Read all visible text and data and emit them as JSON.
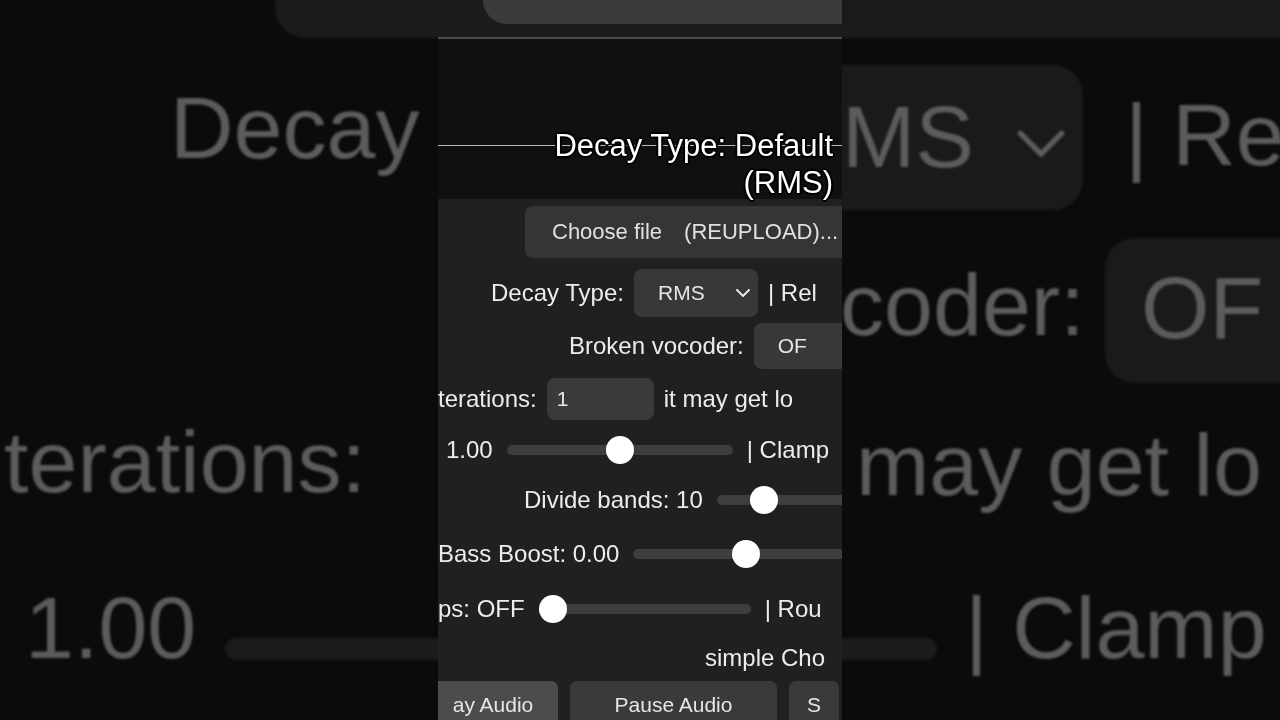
{
  "backdrop": {
    "left": [
      {
        "kind": "text",
        "text": "Decay"
      },
      {
        "kind": "text",
        "text": "terations:"
      },
      {
        "kind": "slider",
        "text": "1.00"
      }
    ],
    "right": [
      {
        "kind": "select",
        "text": "MS"
      },
      {
        "kind": "text",
        "text": "| Re"
      },
      {
        "kind": "text",
        "text": "coder:"
      },
      {
        "kind": "button",
        "text": "OF"
      },
      {
        "kind": "text",
        "text": "may get lo"
      },
      {
        "kind": "slider",
        "text": "| Clamp"
      }
    ]
  },
  "caption": [
    "Decay Type: Default",
    "(RMS)"
  ],
  "rows": [
    {
      "kind": "file",
      "button": "Choose file",
      "file": "(REUPLOAD)..."
    },
    {
      "kind": "select",
      "label": "Decay Type:",
      "value": "RMS",
      "after": "| Rel"
    },
    {
      "kind": "toggle",
      "label": "Broken vocoder:",
      "value": "OF"
    },
    {
      "kind": "number",
      "label": "terations:",
      "value": "1",
      "after": "it may get lo"
    },
    {
      "kind": "slider",
      "label": "1.00",
      "level": 0.5,
      "after": "| Clamp"
    },
    {
      "kind": "slider",
      "label": "Divide bands: 10",
      "level": 0.26
    },
    {
      "kind": "slider",
      "label": "Bass Boost: 0.00",
      "level": 0.5
    },
    {
      "kind": "slider",
      "label": "ps: OFF",
      "level": 0,
      "after": "| Rou"
    },
    {
      "kind": "text",
      "label": "simple Cho"
    }
  ],
  "buttons": [
    {
      "label": "ay Audio",
      "selected": true
    },
    {
      "label": "Pause Audio",
      "selected": false
    },
    {
      "label": "S",
      "selected": false
    }
  ]
}
